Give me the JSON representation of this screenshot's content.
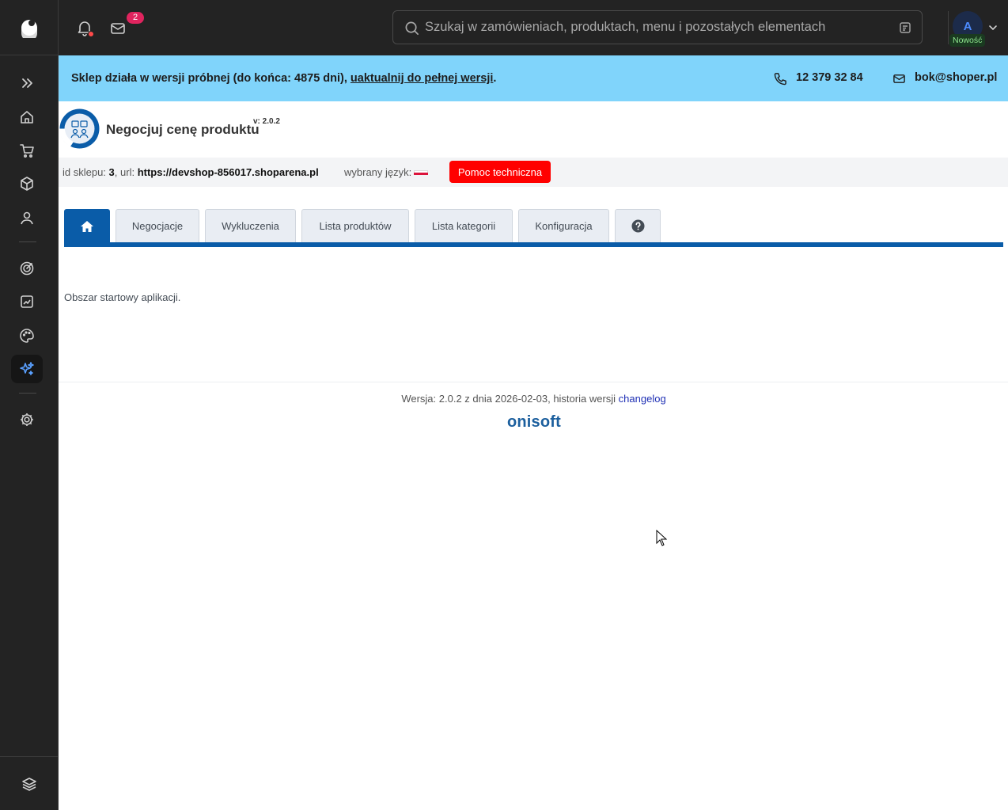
{
  "topbar": {
    "notifications_count": "2",
    "search_placeholder": "Szukaj w zamówieniach, produktach, menu i pozostałych elementach",
    "avatar_initial": "A",
    "new_badge": "Nowość"
  },
  "banner": {
    "text_before": "Sklep działa w wersji próbnej (do końca: 4875 dni), ",
    "link": "uaktualnij do pełnej wersji",
    "text_after": ".",
    "phone": "12 379 32 84",
    "email": "bok@shoper.pl"
  },
  "app": {
    "title": "Negocjuj cenę produktu",
    "version": "v: 2.0.2"
  },
  "info": {
    "shop_id_label": "id sklepu: ",
    "shop_id": "3",
    "url_label": ", url: ",
    "url": "https://devshop-856017.shoparena.pl",
    "lang_label": "wybrany język: ",
    "help_button": "Pomoc techniczna"
  },
  "tabs": [
    {
      "label": "Negocjacje"
    },
    {
      "label": "Wykluczenia"
    },
    {
      "label": "Lista produktów"
    },
    {
      "label": "Lista kategorii"
    },
    {
      "label": "Konfiguracja"
    }
  ],
  "content": {
    "start_text": "Obszar startowy aplikacji."
  },
  "footer": {
    "version_text": "Wersja: 2.0.2 z dnia 2026-02-03, historia wersji ",
    "changelog_link": "changelog",
    "brand": "onisoft"
  },
  "colors": {
    "sidebar_bg": "#232323",
    "banner_bg": "#80d4fb",
    "tab_active": "#0a5ca8",
    "help_button": "#ff0000",
    "badge": "#e0245e"
  },
  "icons": {
    "sidebar": [
      "expand-icon",
      "home-icon",
      "cart-icon",
      "box-icon",
      "user-icon",
      "target-icon",
      "chart-icon",
      "palette-icon",
      "sparkles-icon",
      "gear-icon",
      "layers-icon"
    ]
  }
}
